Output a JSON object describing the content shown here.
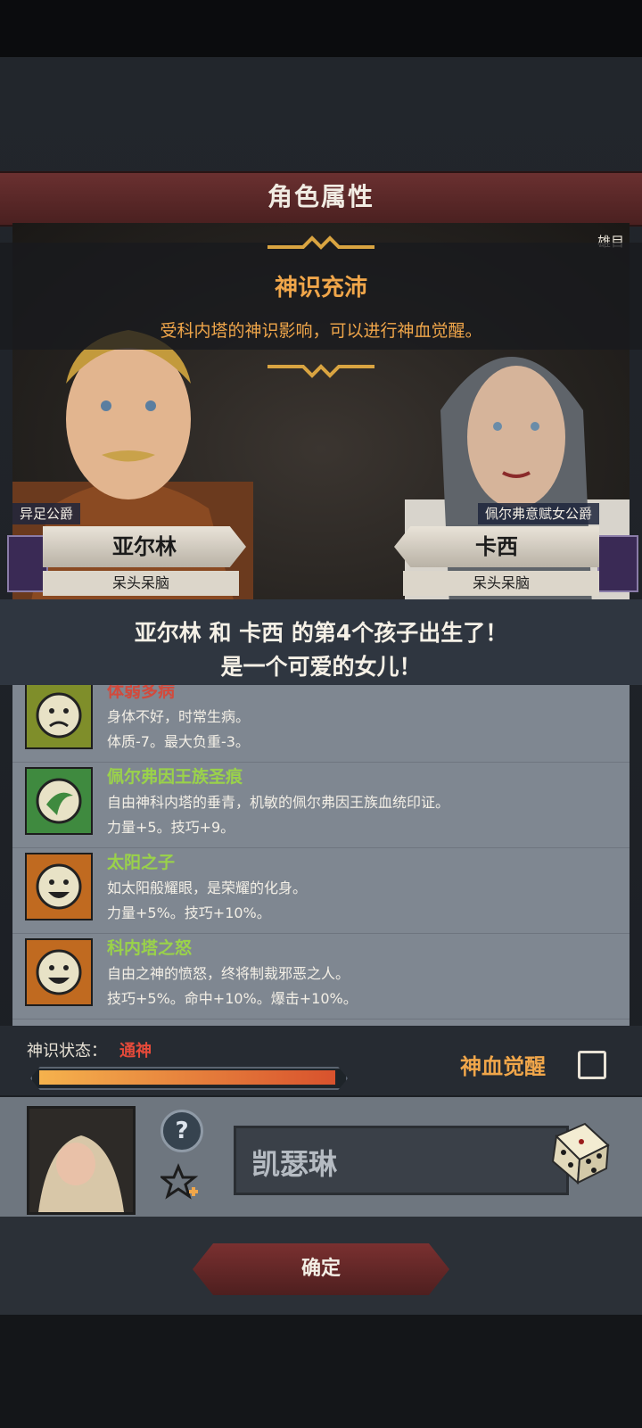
{
  "header": {
    "title": "角色属性"
  },
  "scene": {
    "corner_label": "雄目"
  },
  "notice": {
    "title": "神识充沛",
    "description": "受科内塔的神识影响，可以进行神血觉醒。"
  },
  "father": {
    "title": "异足公爵",
    "name": "亚尔林",
    "trait": "呆头呆脑"
  },
  "mother": {
    "title": "佩尔弗意赋女公爵",
    "name": "卡西",
    "trait": "呆头呆脑"
  },
  "announcement": {
    "line1": "亚尔林 和 卡西 的第4个孩子出生了！",
    "line2": "是一个可爱的女儿！"
  },
  "traits": [
    {
      "name": "体弱多病",
      "name_color": "#d24a3c",
      "icon": "sad-face-icon",
      "icon_bg": "#7f8e2a",
      "desc": "身体不好，时常生病。",
      "stat": "体质-7。最大负重-3。"
    },
    {
      "name": "佩尔弗因王族圣痕",
      "name_color": "#9ad24a",
      "icon": "crescent-swirl-icon",
      "icon_bg": "#3f8a3f",
      "desc": "自由神科内塔的垂青，机敏的佩尔弗因王族血统印证。",
      "stat": "力量+5。技巧+9。"
    },
    {
      "name": "太阳之子",
      "name_color": "#9ad24a",
      "icon": "smile-face-icon",
      "icon_bg": "#c06a20",
      "desc": "如太阳般耀眼，是荣耀的化身。",
      "stat": "力量+5%。技巧+10%。"
    },
    {
      "name": "科内塔之怒",
      "name_color": "#9ad24a",
      "icon": "smile-face-icon",
      "icon_bg": "#c06a20",
      "desc": "自由之神的愤怒，终将制裁邪恶之人。",
      "stat": "技巧+5%。命中+10%。爆击+10%。"
    }
  ],
  "divine_status": {
    "label": "神识状态：",
    "value": "通神",
    "level": 1.0
  },
  "awaken": {
    "label": "神血觉醒",
    "checked": false
  },
  "child": {
    "name": "凯瑟琳"
  },
  "confirm_label": "确定"
}
